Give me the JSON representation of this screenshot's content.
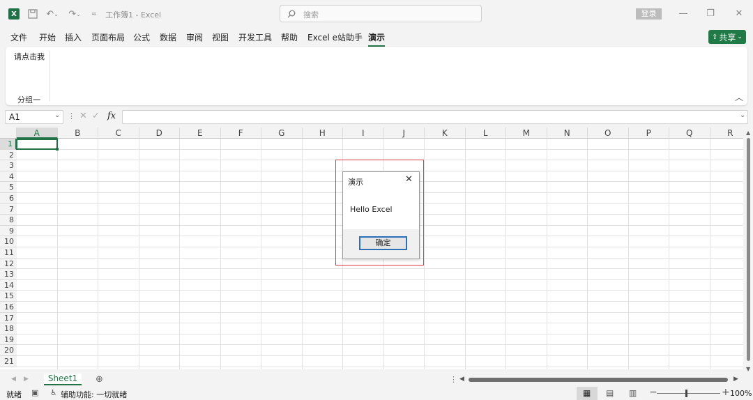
{
  "titlebar": {
    "window_title": "工作簿1  -  Excel",
    "search_placeholder": "搜索",
    "login_label": "登录"
  },
  "menu": {
    "tabs": [
      "文件",
      "开始",
      "插入",
      "页面布局",
      "公式",
      "数据",
      "审阅",
      "视图",
      "开发工具",
      "帮助",
      "Excel e站助手",
      "演示"
    ],
    "active_tab": "演示",
    "share_label": "共享"
  },
  "ribbon": {
    "button_label": "请点击我",
    "group_label": "分组一"
  },
  "formula_bar": {
    "name_box": "A1",
    "fx": "fx",
    "value": ""
  },
  "grid": {
    "columns": [
      "A",
      "B",
      "C",
      "D",
      "E",
      "F",
      "G",
      "H",
      "I",
      "J",
      "K",
      "L",
      "M",
      "N",
      "O",
      "P",
      "Q",
      "R"
    ],
    "rows": [
      "1",
      "2",
      "3",
      "4",
      "5",
      "6",
      "7",
      "8",
      "9",
      "10",
      "11",
      "12",
      "13",
      "14",
      "15",
      "16",
      "17",
      "18",
      "19",
      "20",
      "21"
    ],
    "selected_cell": "A1"
  },
  "sheets": {
    "tabs": [
      "Sheet1"
    ],
    "active": "Sheet1"
  },
  "status": {
    "ready": "就绪",
    "accessibility": "辅助功能: 一切就绪",
    "zoom": "100%"
  },
  "dialog": {
    "title": "演示",
    "message": "Hello Excel",
    "ok_label": "确定"
  },
  "colors": {
    "accent": "#217346",
    "highlight": "#e0393f",
    "share": "#1f7a45"
  }
}
